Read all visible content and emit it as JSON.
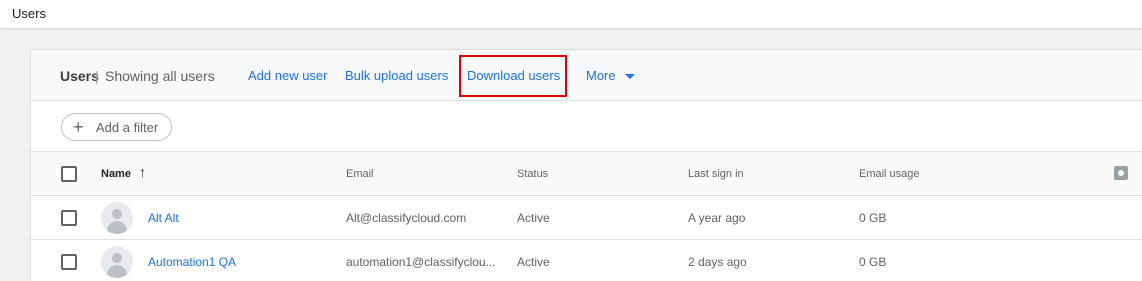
{
  "topbar": {
    "title": "Users"
  },
  "header": {
    "title": "Users",
    "separator": "|",
    "subtitle": "Showing all users",
    "actions": {
      "add_new_user": "Add new user",
      "bulk_upload": "Bulk upload users",
      "download": "Download users",
      "more": "More"
    }
  },
  "filter": {
    "plus": "+",
    "label": "Add a filter"
  },
  "columns": {
    "name": "Name",
    "sort": "↑",
    "email": "Email",
    "status": "Status",
    "last_sign_in": "Last sign in",
    "email_usage": "Email usage"
  },
  "rows": [
    {
      "name": "Alt Alt",
      "email": "Alt@classifycloud.com",
      "status": "Active",
      "last_sign_in": "A year ago",
      "usage": "0 GB"
    },
    {
      "name": "Automation1 QA",
      "email": "automation1@classifyclou...",
      "status": "Active",
      "last_sign_in": "2 days ago",
      "usage": "0 GB"
    }
  ],
  "colors": {
    "link": "#1a73e8",
    "highlight": "#e00000"
  }
}
